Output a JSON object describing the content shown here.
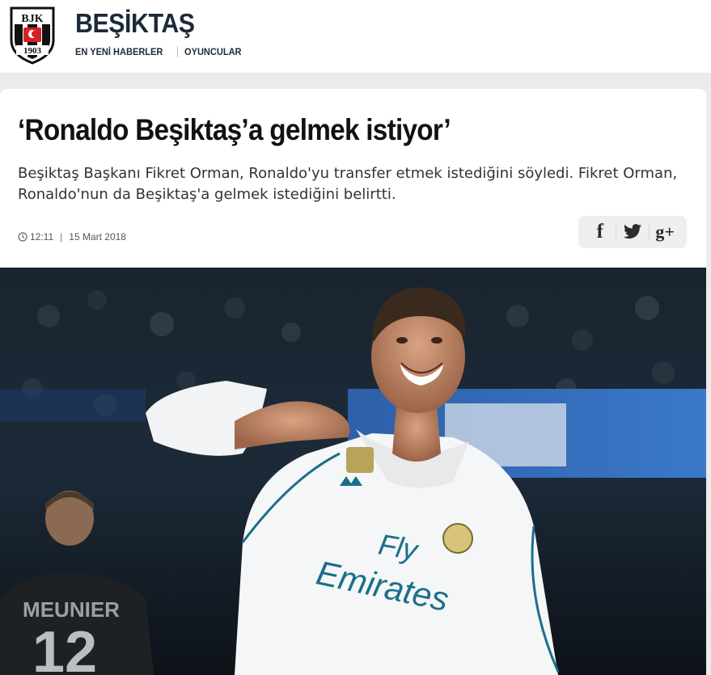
{
  "site": {
    "brand": "BEŞİKTAŞ",
    "logo": {
      "icon": "bjk-crest-icon",
      "text_top": "BJK",
      "text_bottom": "1903"
    },
    "nav": [
      {
        "label": "EN YENİ HABERLER"
      },
      {
        "label": "OYUNCULAR"
      }
    ]
  },
  "article": {
    "headline": "‘Ronaldo Beşiktaş’a gelmek istiyor’",
    "summary": "Beşiktaş Başkanı Fikret Orman, Ronaldo'yu transfer etmek istediğini söyledi. Fikret Orman, Ronaldo'nun da Beşiktaş'a gelmek istediğini belirtti.",
    "time": "12:11",
    "date": "15 Mart 2018",
    "share": [
      {
        "icon": "facebook-icon",
        "glyph": "f"
      },
      {
        "icon": "twitter-icon"
      },
      {
        "icon": "google-plus-icon",
        "glyph": "g+"
      }
    ],
    "image": {
      "subject": "football player celebrating in white kit",
      "shirt_sponsor_line1": "Fly",
      "shirt_sponsor_line2": "Emirates",
      "background_player_name": "MEUNIER",
      "background_player_number": "12"
    }
  },
  "colors": {
    "brand_text": "#1c2a38",
    "page_bg": "#ebebeb",
    "card_bg": "#ffffff",
    "share_bg": "#efefef",
    "kit_accent": "#1b6f8a"
  }
}
